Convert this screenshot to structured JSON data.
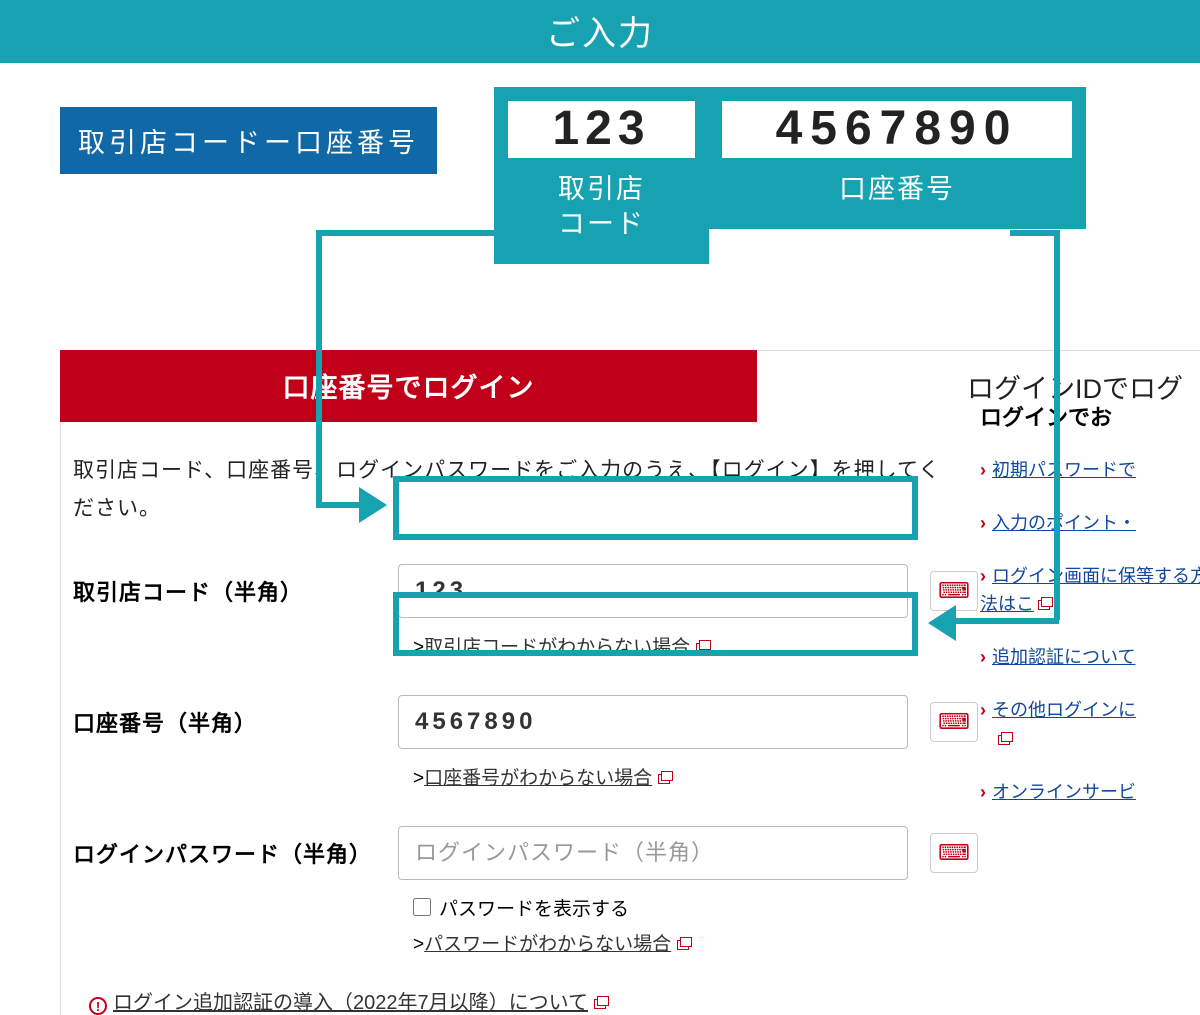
{
  "header": {
    "title": "ご入力"
  },
  "explain": {
    "label": "取引店コードー口座番号",
    "code_digits": "123",
    "acct_digits": "4567890",
    "code_sub": "取引店\nコード",
    "acct_sub": "口座番号",
    "dash": "-"
  },
  "tabs": {
    "active": "口座番号でログイン",
    "inactive": "ログインIDでログ"
  },
  "panel": {
    "instruction": "取引店コード、口座番号、ログインパスワードをご入力のうえ、【ログイン】を押してください。",
    "row1": {
      "label": "取引店コード（半角）",
      "value": "123",
      "help": "取引店コードがわからない場合"
    },
    "row2": {
      "label": "口座番号（半角）",
      "value": "4567890",
      "help": "口座番号がわからない場合"
    },
    "row3": {
      "label": "ログインパスワード（半角）",
      "placeholder": "ログインパスワード（半角）",
      "checkbox": "パスワードを表示する",
      "help": "パスワードがわからない場合"
    },
    "notice": "ログイン追加認証の導入（2022年7月以降）について",
    "help_prefix": ">"
  },
  "side": {
    "heading": "ログインでお",
    "links": [
      "初期パスワードで",
      "入力のポイント・",
      "ログイン画面に保等する方法はこ",
      "追加認証について",
      "その他ログインに",
      "オンラインサービ"
    ]
  },
  "partial": {
    "text": "パスワード"
  }
}
